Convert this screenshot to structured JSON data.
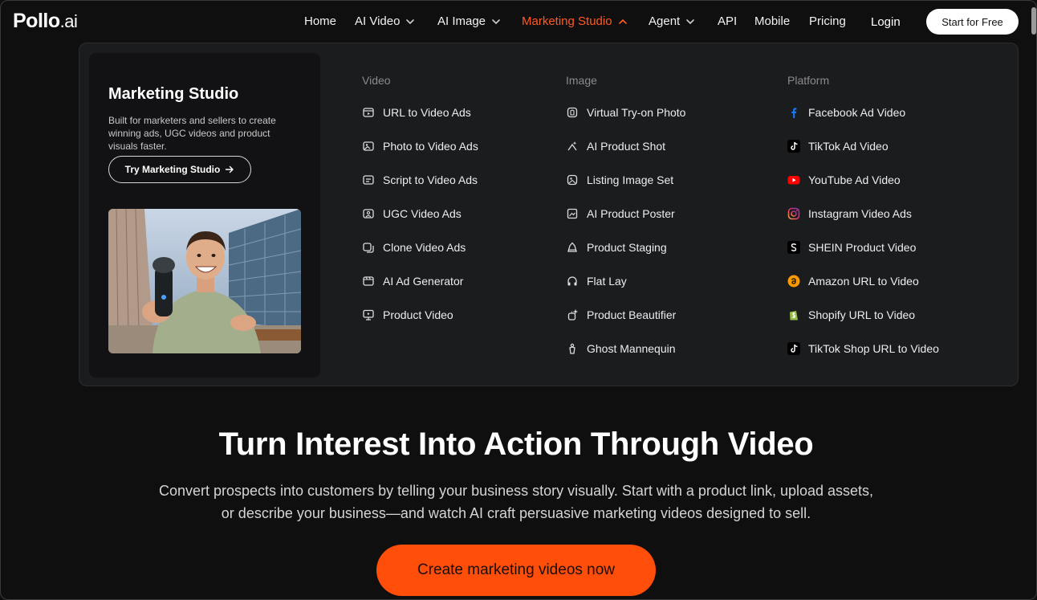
{
  "brand": {
    "name": "Pollo",
    "suffix": ".ai"
  },
  "nav": {
    "items": [
      {
        "label": "Home"
      },
      {
        "label": "AI Video"
      },
      {
        "label": "AI Image"
      },
      {
        "label": "Marketing Studio"
      },
      {
        "label": "Agent"
      },
      {
        "label": "API"
      },
      {
        "label": "Mobile"
      },
      {
        "label": "Pricing"
      }
    ],
    "login": "Login",
    "start": "Start for Free"
  },
  "dropdown": {
    "promo": {
      "title": "Marketing Studio",
      "description": "Built for marketers and sellers to create winning ads, UGC videos and product visuals faster.",
      "button": "Try Marketing Studio"
    },
    "columns": [
      {
        "title": "Video",
        "items": [
          "URL to Video Ads",
          "Photo to Video Ads",
          "Script to Video Ads",
          "UGC Video Ads",
          "Clone Video Ads",
          "AI Ad Generator",
          "Product Video"
        ]
      },
      {
        "title": "Image",
        "items": [
          "Virtual Try-on Photo",
          "AI Product Shot",
          "Listing Image Set",
          "AI Product Poster",
          "Product Staging",
          "Flat Lay",
          "Product Beautifier",
          "Ghost Mannequin"
        ]
      },
      {
        "title": "Platform",
        "items": [
          "Facebook Ad Video",
          "TikTok Ad Video",
          "YouTube Ad Video",
          "Instagram Video Ads",
          "SHEIN Product Video",
          "Amazon URL to Video",
          "Shopify URL to Video",
          "TikTok Shop URL to Video"
        ]
      }
    ]
  },
  "hero": {
    "title": "Turn Interest Into Action Through Video",
    "subtitle": "Convert prospects into customers by telling your business story visually. Start with a product link, upload assets, or describe your business—and watch AI craft persuasive marketing videos designed to sell.",
    "cta": "Create marketing videos now"
  },
  "colors": {
    "accent": "#ff4d0a",
    "active_nav": "#ff5a1f",
    "background": "#0f0f10",
    "panel": "#1b1c1e"
  },
  "icons": {
    "video": [
      "url-video-icon",
      "photo-video-icon",
      "script-video-icon",
      "ugc-video-icon",
      "clone-video-icon",
      "ad-generator-icon",
      "product-video-icon"
    ],
    "image": [
      "tryon-icon",
      "product-shot-icon",
      "listing-icon",
      "poster-icon",
      "staging-icon",
      "flat-lay-icon",
      "beautifier-icon",
      "mannequin-icon"
    ],
    "platform": [
      "facebook-icon",
      "tiktok-icon",
      "youtube-icon",
      "instagram-icon",
      "shein-icon",
      "amazon-icon",
      "shopify-icon",
      "tiktok-shop-icon"
    ]
  }
}
